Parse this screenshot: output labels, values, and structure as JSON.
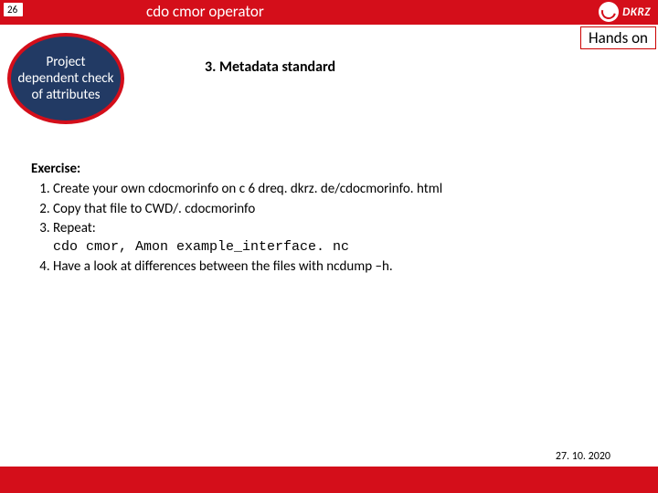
{
  "header": {
    "slide_number": "26",
    "title": "cdo cmor operator",
    "logo_text": "DKRZ"
  },
  "hands_on_label": "Hands on",
  "ellipse_text": "Project dependent check of attributes",
  "section_title": "3. Metadata standard",
  "exercise": {
    "heading": "Exercise:",
    "items": [
      {
        "text": "Create your own cdocmorinfo on c 6 dreq. dkrz. de/cdocmorinfo. html"
      },
      {
        "text": "Copy that file to CWD/. cdocmorinfo"
      },
      {
        "text": "Repeat:",
        "code": "cdo cmor, Amon example_interface. nc"
      },
      {
        "text": "Have a look at differences between the files with ncdump –h."
      }
    ]
  },
  "footer": {
    "date": "27. 10. 2020"
  }
}
